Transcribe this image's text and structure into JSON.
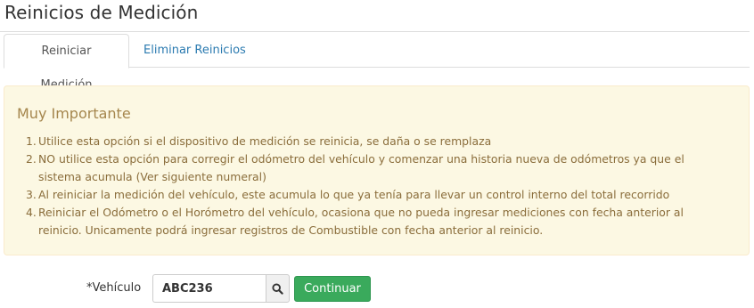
{
  "page": {
    "title": "Reinicios de Medición"
  },
  "tabs": [
    {
      "label": "Reiniciar Medición",
      "active": true
    },
    {
      "label": "Eliminar Reinicios",
      "active": false
    }
  ],
  "alert": {
    "heading": "Muy Importante",
    "items": [
      {
        "num": "1.",
        "text": "Utilice esta opción si el dispositivo de medición se reinicia, se daña o se remplaza"
      },
      {
        "num": "2.",
        "text": "NO utilice esta opción para corregir el odómetro del vehículo y comenzar una historia nueva de odómetros ya que el sistema acumula (Ver siguiente numeral)"
      },
      {
        "num": "3.",
        "text": "Al reiniciar la medición del vehículo, este acumula lo que ya tenía para llevar un control interno del total recorrido"
      },
      {
        "num": "4.",
        "text": "Reiniciar el Odómetro o el Horómetro del vehículo, ocasiona que no pueda ingresar mediciones con fecha anterior al reinicio. Unicamente podrá ingresar registros de Combustible con fecha anterior al reinicio."
      }
    ]
  },
  "form": {
    "vehicle_label": "*Vehículo",
    "vehicle_value": "ABC236",
    "search_icon": "search-icon",
    "continue_label": "Continuar"
  },
  "colors": {
    "alert_bg": "#fcf8e3",
    "alert_text": "#8a6d3b",
    "link": "#2a7ab0",
    "success": "#3aaa5c"
  }
}
